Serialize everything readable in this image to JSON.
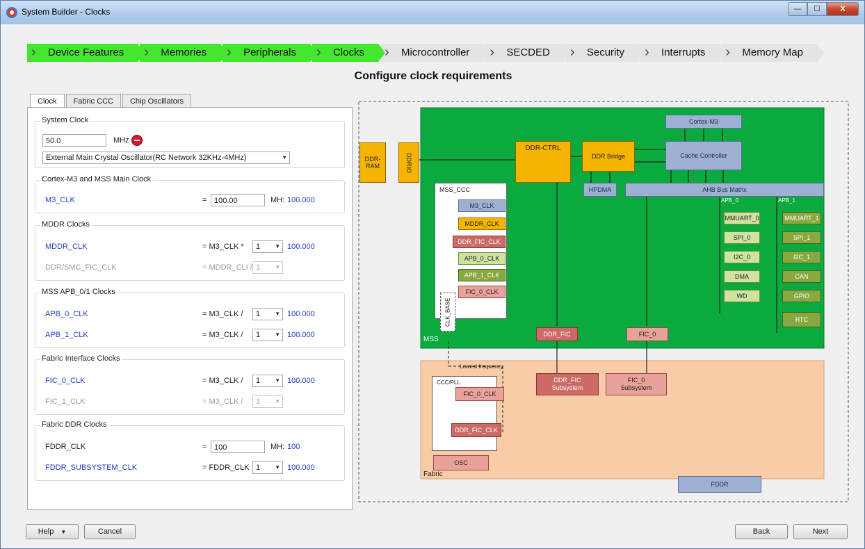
{
  "window": {
    "title": "System Builder - Clocks",
    "minimize": "—",
    "maximize": "☐",
    "close": "X"
  },
  "wizard": {
    "steps": [
      {
        "label": "Device Features",
        "done": true
      },
      {
        "label": "Memories",
        "done": true
      },
      {
        "label": "Peripherals",
        "done": true
      },
      {
        "label": "Clocks",
        "done": true
      },
      {
        "label": "Microcontroller",
        "done": false
      },
      {
        "label": "SECDED",
        "done": false
      },
      {
        "label": "Security",
        "done": false
      },
      {
        "label": "Interrupts",
        "done": false
      },
      {
        "label": "Memory Map",
        "done": false
      }
    ],
    "chevron": "›"
  },
  "heading": "Configure clock requirements",
  "tabs": [
    "Clock",
    "Fabric CCC",
    "Chip Oscillators"
  ],
  "system_clock": {
    "title": "System Clock",
    "value": "50.0",
    "unit": "MHz",
    "source": "External Main Crystal Oscillator(RC Network 32KHz-4MHz)"
  },
  "m3_group": {
    "title": "Cortex-M3 and MSS Main Clock",
    "m3_clk": {
      "label": "M3_CLK",
      "eq": "=",
      "value": "100.00",
      "unit": "MH:",
      "result": "100.000"
    }
  },
  "mddr_group": {
    "title": "MDDR Clocks",
    "mddr_clk": {
      "label": "MDDR_CLK",
      "eq": "= M3_CLK *",
      "div": "1",
      "result": "100.000"
    },
    "ddr_smc": {
      "label": "DDR/SMC_FIC_CLK",
      "eq": "= MDDR_CLI /",
      "div": "1"
    }
  },
  "apb_group": {
    "title": "MSS APB_0/1 Clocks",
    "apb0": {
      "label": "APB_0_CLK",
      "eq": "= M3_CLK /",
      "div": "1",
      "result": "100.000"
    },
    "apb1": {
      "label": "APB_1_CLK",
      "eq": "= M3_CLK /",
      "div": "1",
      "result": "100.000"
    }
  },
  "fic_group": {
    "title": "Fabric Interface Clocks",
    "fic0": {
      "label": "FIC_0_CLK",
      "eq": "= M3_CLK /",
      "div": "1",
      "result": "100.000"
    },
    "fic1": {
      "label": "FIC_1_CLK",
      "eq": "= M3_CLK /",
      "div": "1"
    }
  },
  "fddr_group": {
    "title": "Fabric DDR Clocks",
    "fddr": {
      "label": "FDDR_CLK",
      "eq": "=",
      "value": "100",
      "unit": "MH:",
      "result": "100"
    },
    "fddr_sub": {
      "label": "FDDR_SUBSYSTEM_CLK",
      "eq": "= FDDR_CLK",
      "div": "1",
      "result": "100.000"
    }
  },
  "diagram": {
    "ddr_ram": "DDR-\nRAM",
    "ddrio": "DDRIO",
    "ddr_ctrl": "DDR-CTRL",
    "ddr_bridge": "DDR Bridge",
    "cortex": "Cortex-M3",
    "cache": "Cache Controller",
    "hpdma": "HPDMA",
    "ahb": "AHB Bus Matrix",
    "apb0_bus": "APB_0",
    "apb1_bus": "APB_1",
    "mss_ccc": "MSS_CCC",
    "ccc_clocks": [
      "M3_CLK",
      "MDDR_CLK",
      "DDR_FIC_CLK",
      "APB_0_CLK",
      "APB_1_CLK",
      "FIC_0_CLK"
    ],
    "clk_base": "CLK_BASE",
    "mss": "MSS",
    "apb0_periph": [
      "MMUART_0",
      "SPI_0",
      "I2C_0",
      "DMA",
      "WD"
    ],
    "apb1_periph": [
      "MMUART_1",
      "SPI_1",
      "I2C_1",
      "CAN",
      "GPIO",
      "RTC"
    ],
    "ddr_fic": "DDR_FIC",
    "fic_0": "FIC_0",
    "lowest": "Lowest frequency",
    "ddr_fic_sub": "DDR_FIC\nSubsystem",
    "fic_0_sub": "FIC_0\nSubsystem",
    "ccc_pll": "CCC/PLL",
    "fic0_clk_f": "FIC_0_CLK",
    "ddr_fic_clk_f": "DDR_FIC_CLK",
    "osc": "OSC",
    "fabric": "Fabric",
    "fddr": "FDDR"
  },
  "footer": {
    "help": "Help",
    "cancel": "Cancel",
    "back": "Back",
    "next": "Next"
  }
}
